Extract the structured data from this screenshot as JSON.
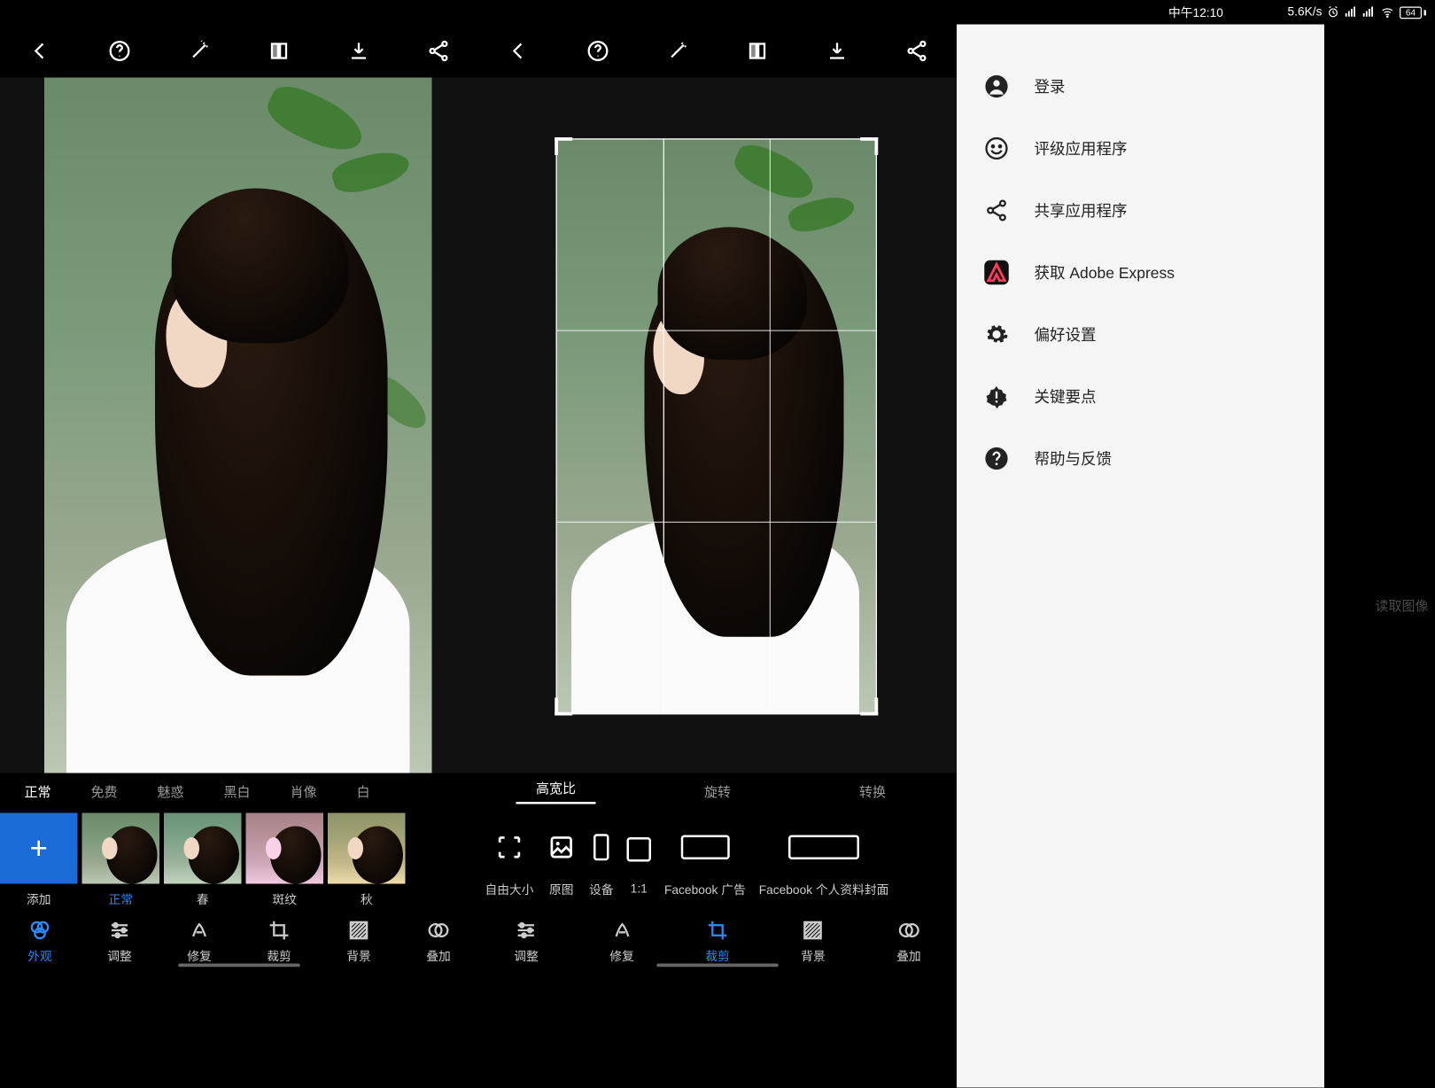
{
  "status": {
    "time": "中午12:10",
    "speed": "5.6K/s",
    "battery": "64"
  },
  "panel1": {
    "filter_tabs": [
      "正常",
      "免费",
      "魅惑",
      "黑白",
      "肖像",
      "白"
    ],
    "thumbs": {
      "add": "添加",
      "items": [
        "正常",
        "春",
        "斑纹",
        "秋"
      ]
    },
    "bottom": [
      "外观",
      "调整",
      "修复",
      "裁剪",
      "背景",
      "叠加"
    ]
  },
  "panel2": {
    "tabs": [
      "高宽比",
      "旋转",
      "转换"
    ],
    "crops": [
      "自由大小",
      "原图",
      "设备",
      "1:1",
      "Facebook 广告",
      "Facebook 个人资料封面"
    ],
    "bottom": [
      "调整",
      "修复",
      "裁剪",
      "背景",
      "叠加"
    ]
  },
  "drawer": {
    "items": [
      "登录",
      "评级应用程序",
      "共享应用程序",
      "获取 Adobe Express",
      "偏好设置",
      "关键要点",
      "帮助与反馈"
    ],
    "overlay_hint": "读取图像"
  }
}
